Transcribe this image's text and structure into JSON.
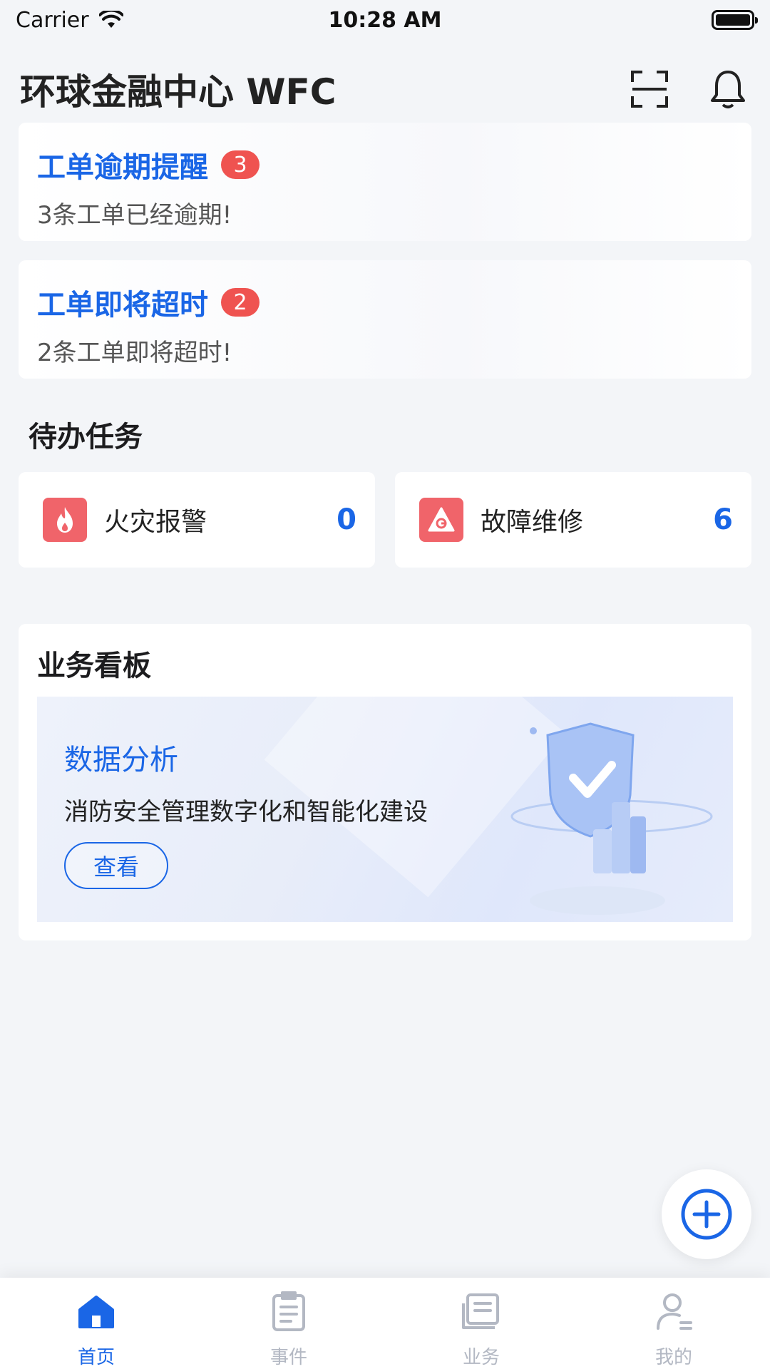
{
  "status_bar": {
    "carrier": "Carrier",
    "time": "10:28 AM"
  },
  "header": {
    "title": "环球金融中心 WFC"
  },
  "alerts": [
    {
      "title": "工单逾期提醒",
      "badge": "3",
      "desc": "3条工单已经逾期!"
    },
    {
      "title": "工单即将超时",
      "badge": "2",
      "desc": "2条工单即将超时!"
    }
  ],
  "todo": {
    "title": "待办任务",
    "items": [
      {
        "label": "火灾报警",
        "count": "0",
        "icon": "fire-icon"
      },
      {
        "label": "故障维修",
        "count": "6",
        "icon": "fault-icon"
      }
    ]
  },
  "dashboard": {
    "title": "业务看板",
    "banner": {
      "heading": "数据分析",
      "text": "消防安全管理数字化和智能化建设",
      "button": "查看"
    }
  },
  "tabs": [
    {
      "label": "首页",
      "icon": "home-icon",
      "active": true
    },
    {
      "label": "事件",
      "icon": "document-icon",
      "active": false
    },
    {
      "label": "业务",
      "icon": "book-icon",
      "active": false
    },
    {
      "label": "我的",
      "icon": "user-icon",
      "active": false
    }
  ],
  "colors": {
    "accent": "#1a66e6",
    "badge": "#ef5350",
    "task_icon": "#f0646a"
  }
}
